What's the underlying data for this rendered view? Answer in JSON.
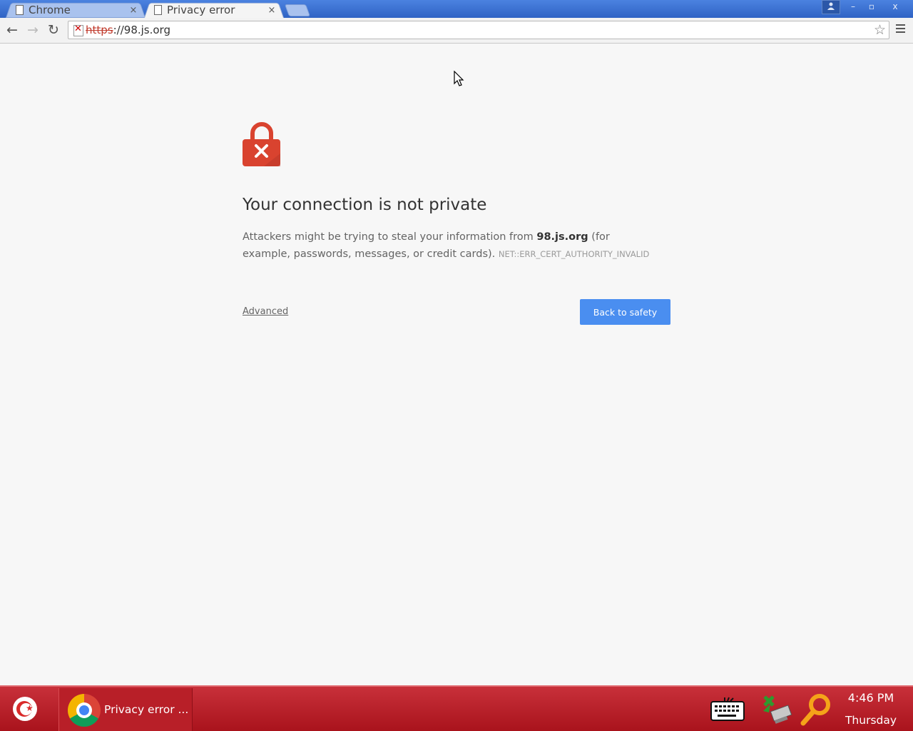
{
  "tabs": [
    {
      "title": "Chrome",
      "close": "×"
    },
    {
      "title": "Privacy error",
      "close": "×"
    }
  ],
  "window_controls": {
    "minimize": "–",
    "maximize": "▫",
    "close": "x"
  },
  "address_bar": {
    "scheme": "https",
    "rest": "://98.js.org"
  },
  "page": {
    "heading": "Your connection is not private",
    "para_before": "Attackers might be trying to steal your information from ",
    "host": "98.js.org",
    "para_after": " (for example, passwords, messages, or credit cards). ",
    "error_code": "NET::ERR_CERT_AUTHORITY_INVALID",
    "advanced_link": "Advanced",
    "back_button": "Back to safety"
  },
  "taskbar": {
    "task_label": "Privacy error ...",
    "time": "4:46 PM",
    "day": "Thursday"
  },
  "colors": {
    "lock_red": "#d9432f",
    "button_blue": "#4a8ef0",
    "taskbar_red": "#b81f28"
  }
}
